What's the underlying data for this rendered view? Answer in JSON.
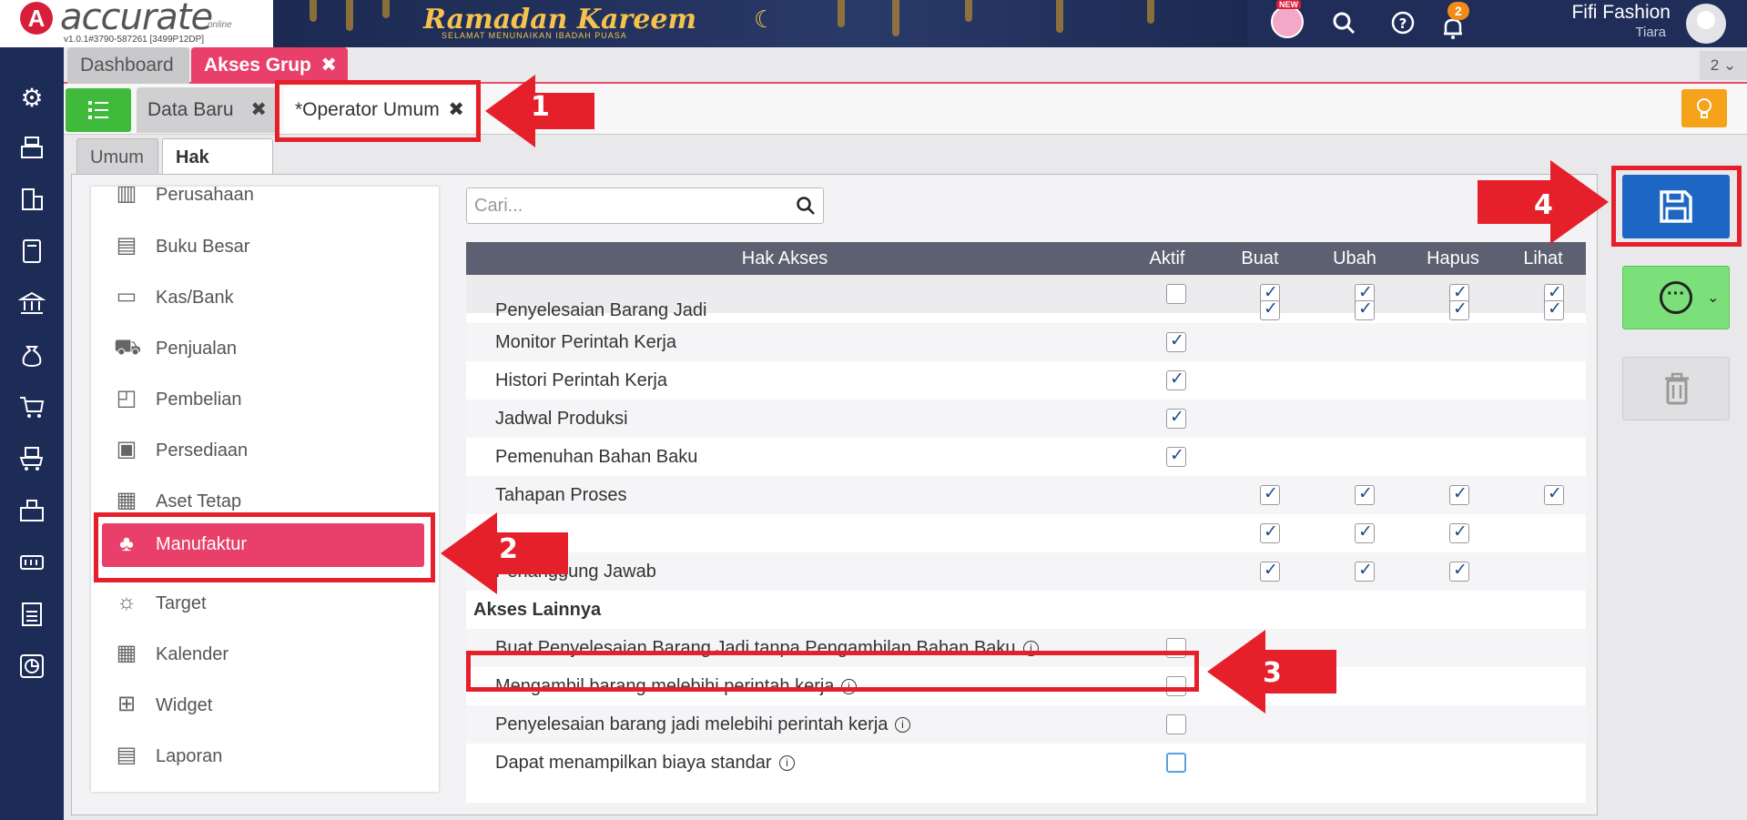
{
  "app": {
    "logo_letter": "A",
    "logo_name": "accurate",
    "logo_sub": "online",
    "version": "v1.0.1#3790-587261 [3499P12DP]"
  },
  "banner": {
    "title": "Ramadan Kareem",
    "subtitle": "SELAMAT MENUNAIKAN IBADAH PUASA"
  },
  "header": {
    "new_badge": "NEW",
    "notification_count": "2",
    "company": "Fifi Fashion",
    "user": "Tiara"
  },
  "tabs_main": [
    {
      "label": "Dashboard",
      "active": false
    },
    {
      "label": "Akses Grup",
      "active": true
    }
  ],
  "tab_count": "2",
  "tabs_sub": [
    {
      "label": "Data Baru"
    },
    {
      "label": "*Operator Umum"
    }
  ],
  "tabs_inner": [
    {
      "label": "Umum"
    },
    {
      "label": "Hak Akses"
    }
  ],
  "menu": [
    {
      "label": "Perusahaan",
      "icon": "building-icon"
    },
    {
      "label": "Buku Besar",
      "icon": "ledger-icon"
    },
    {
      "label": "Kas/Bank",
      "icon": "wallet-icon"
    },
    {
      "label": "Penjualan",
      "icon": "cart-icon"
    },
    {
      "label": "Pembelian",
      "icon": "bag-icon"
    },
    {
      "label": "Persediaan",
      "icon": "box-icon"
    },
    {
      "label": "Aset Tetap",
      "icon": "asset-icon"
    },
    {
      "label": "Manufaktur",
      "icon": "factory-icon",
      "active": true
    },
    {
      "label": "Target",
      "icon": "target-icon"
    },
    {
      "label": "Kalender",
      "icon": "calendar-icon"
    },
    {
      "label": "Widget",
      "icon": "widget-icon"
    },
    {
      "label": "Laporan",
      "icon": "report-icon"
    }
  ],
  "search": {
    "placeholder": "Cari..."
  },
  "table": {
    "headers": [
      "Hak Akses",
      "Aktif",
      "Buat",
      "Ubah",
      "Hapus",
      "Lihat"
    ],
    "filter_row": {
      "aktif": false,
      "buat": true,
      "ubah": true,
      "hapus": true,
      "lihat": true
    },
    "rows": [
      {
        "label": "Penyelesaian Barang Jadi",
        "aktif": null,
        "buat": true,
        "ubah": true,
        "hapus": true,
        "lihat": true
      },
      {
        "label": "Monitor Perintah Kerja",
        "aktif": true,
        "buat": null,
        "ubah": null,
        "hapus": null,
        "lihat": null
      },
      {
        "label": "Histori Perintah Kerja",
        "aktif": true,
        "buat": null,
        "ubah": null,
        "hapus": null,
        "lihat": null
      },
      {
        "label": "Jadwal Produksi",
        "aktif": true,
        "buat": null,
        "ubah": null,
        "hapus": null,
        "lihat": null
      },
      {
        "label": "Pemenuhan Bahan Baku",
        "aktif": true,
        "buat": null,
        "ubah": null,
        "hapus": null,
        "lihat": null
      },
      {
        "label": "Tahapan Proses",
        "aktif": null,
        "buat": true,
        "ubah": true,
        "hapus": true,
        "lihat": true
      },
      {
        "label": "",
        "aktif": null,
        "buat": true,
        "ubah": true,
        "hapus": true,
        "lihat": null
      },
      {
        "label": "Penanggung Jawab",
        "aktif": null,
        "buat": true,
        "ubah": true,
        "hapus": true,
        "lihat": null
      }
    ],
    "section_label": "Akses Lainnya",
    "other": [
      {
        "label": "Buat Penyelesaian Barang Jadi tanpa Pengambilan Bahan Baku",
        "aktif": false
      },
      {
        "label": "Mengambil barang melebihi perintah kerja",
        "aktif": false
      },
      {
        "label": "Penyelesaian barang jadi melebihi perintah kerja",
        "aktif": false
      },
      {
        "label": "Dapat menampilkan biaya standar",
        "aktif": false
      }
    ],
    "info_glyph": "i"
  },
  "annotations": [
    "1",
    "2",
    "3",
    "4"
  ],
  "colors": {
    "accent_pink": "#e8406a",
    "navy": "#1d2b57",
    "save_blue": "#1e66c4",
    "annotation_red": "#e5202a"
  }
}
